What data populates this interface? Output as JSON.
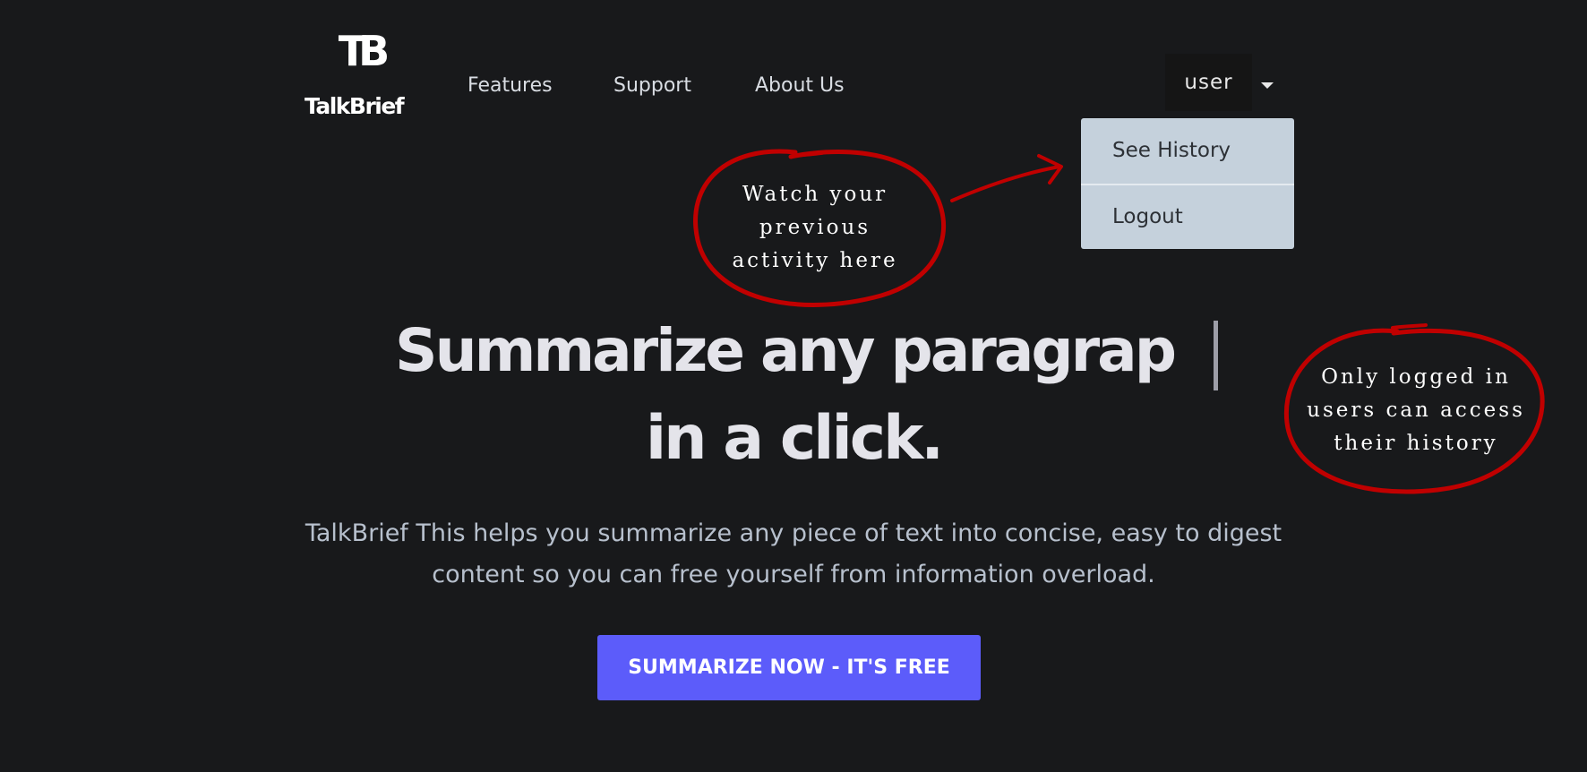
{
  "brand": {
    "logo_mark": "TB",
    "name": "TalkBrief"
  },
  "nav": {
    "items": [
      "Features",
      "Support",
      "About Us"
    ]
  },
  "user_menu": {
    "label": "user",
    "items": [
      "See History",
      "Logout"
    ]
  },
  "annotations": {
    "history_lines": [
      "Watch your",
      "previous",
      "activity here"
    ],
    "access_lines": [
      "Only logged in",
      "users can access",
      "their history"
    ],
    "color": "#c00000"
  },
  "hero": {
    "headline_line1": "Summarize any paragrap",
    "headline_line2": "in a click.",
    "subtitle_line1": "TalkBrief This helps you summarize any piece of text into concise, easy to digest",
    "subtitle_line2": "content so you can free yourself from information overload.",
    "cta_label": "SUMMARIZE NOW - IT'S FREE"
  },
  "colors": {
    "background": "#18191b",
    "accent": "#5c5cfa",
    "dropdown_bg": "#c5d1dc"
  }
}
